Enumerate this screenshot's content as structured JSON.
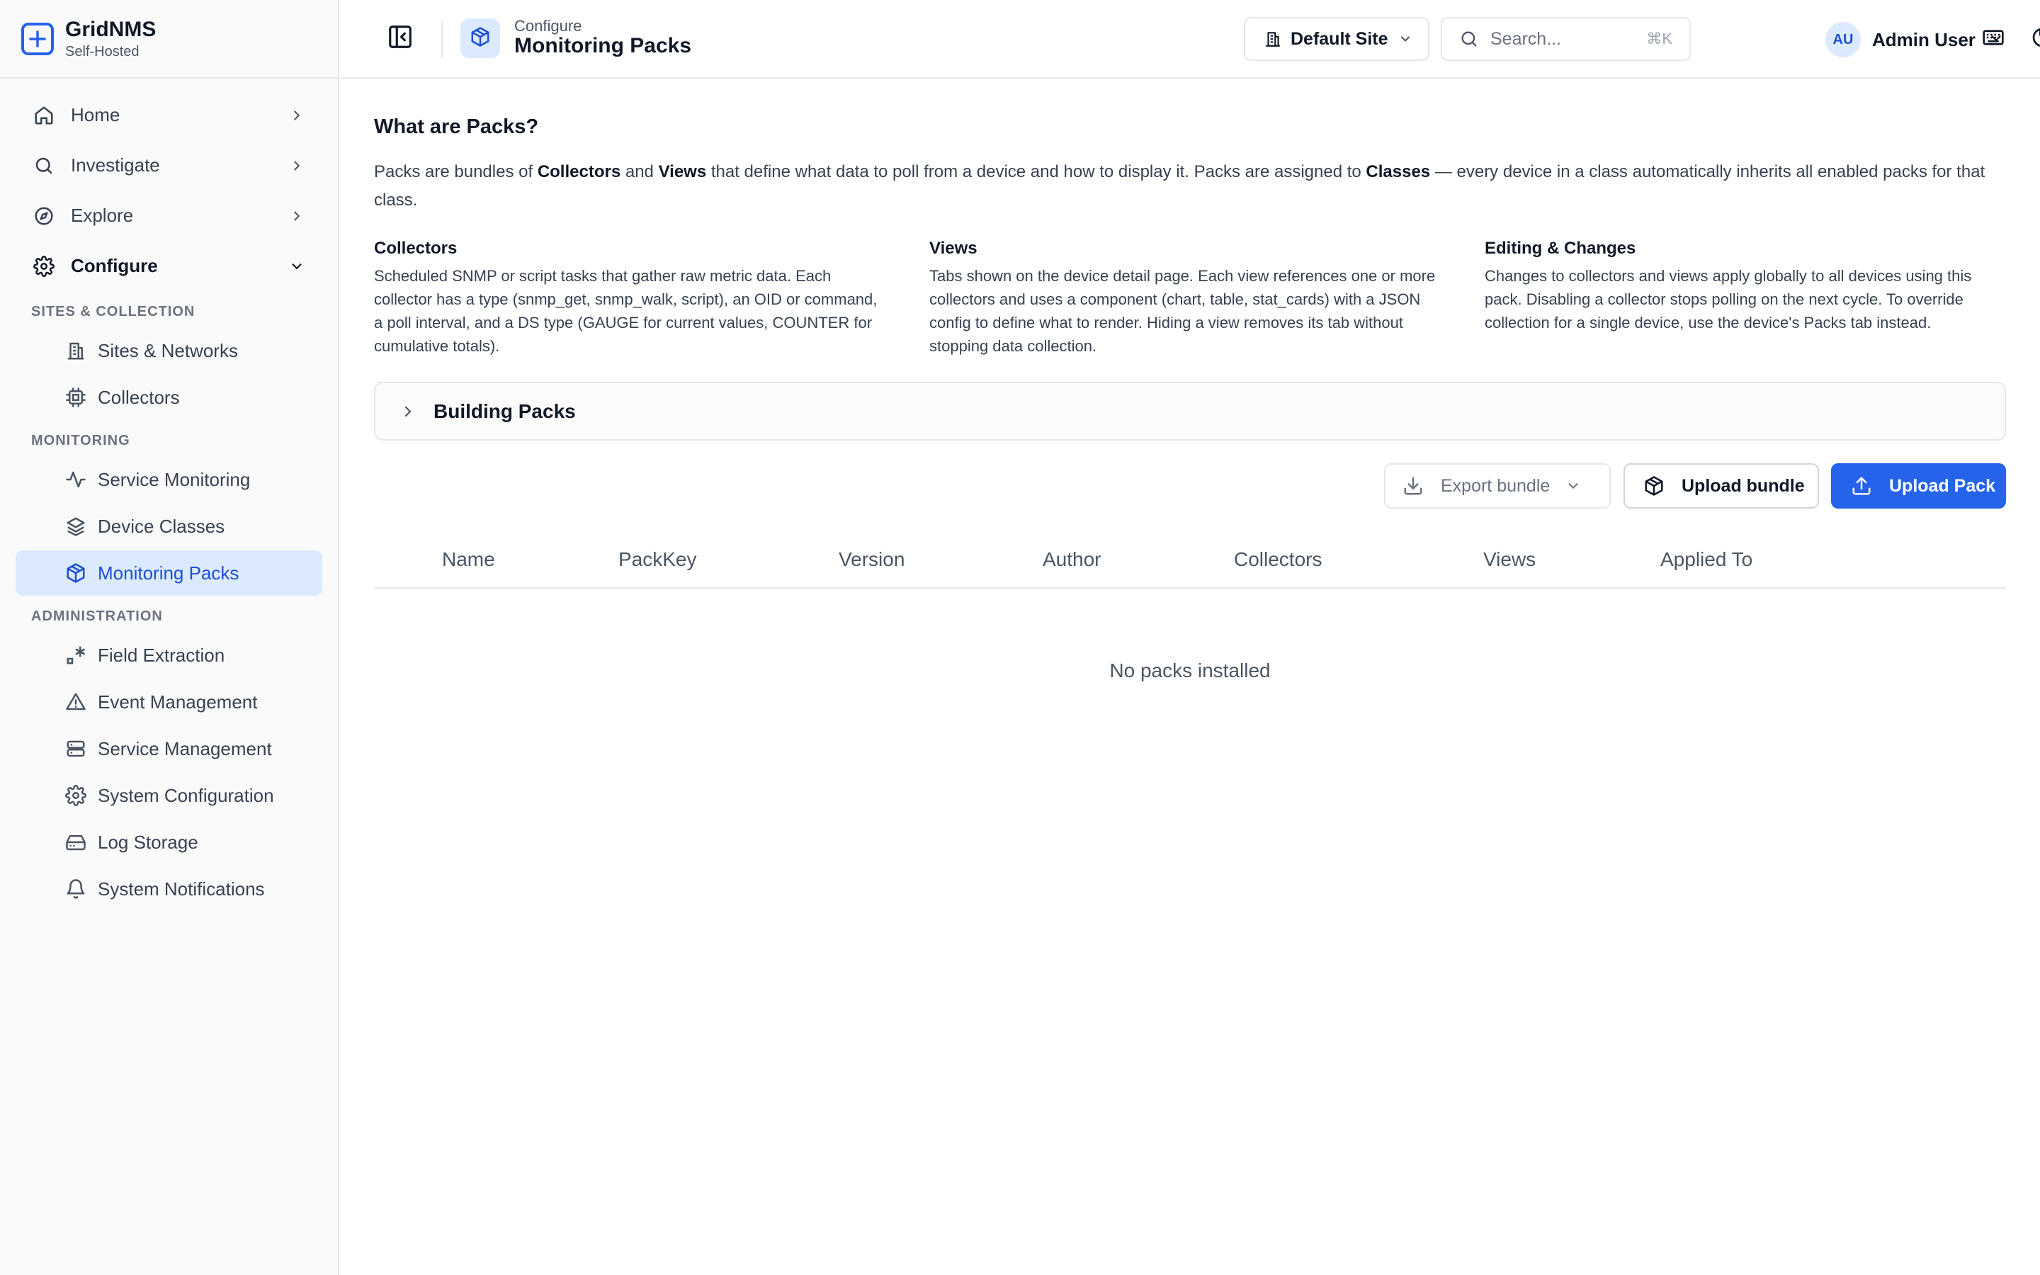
{
  "brand": {
    "name": "GridNMS",
    "subtitle": "Self-Hosted"
  },
  "sidebar": {
    "main_items": [
      {
        "label": "Home",
        "icon": "home-icon"
      },
      {
        "label": "Investigate",
        "icon": "search-icon"
      },
      {
        "label": "Explore",
        "icon": "compass-icon"
      },
      {
        "label": "Configure",
        "icon": "gear-icon",
        "expanded": true
      }
    ],
    "sections": [
      {
        "label": "SITES & COLLECTION",
        "items": [
          {
            "label": "Sites & Networks",
            "icon": "building-icon"
          },
          {
            "label": "Collectors",
            "icon": "cpu-icon"
          }
        ]
      },
      {
        "label": "MONITORING",
        "items": [
          {
            "label": "Service Monitoring",
            "icon": "activity-icon"
          },
          {
            "label": "Device Classes",
            "icon": "layers-icon"
          },
          {
            "label": "Monitoring Packs",
            "icon": "package-icon",
            "active": true
          }
        ]
      },
      {
        "label": "ADMINISTRATION",
        "items": [
          {
            "label": "Field Extraction",
            "icon": "regex-icon"
          },
          {
            "label": "Event Management",
            "icon": "warning-icon"
          },
          {
            "label": "Service Management",
            "icon": "server-icon"
          },
          {
            "label": "System Configuration",
            "icon": "gear-icon"
          },
          {
            "label": "Log Storage",
            "icon": "hard-drive-icon"
          },
          {
            "label": "System Notifications",
            "icon": "bell-icon"
          }
        ]
      }
    ]
  },
  "header": {
    "breadcrumb": "Configure",
    "title": "Monitoring Packs",
    "site_select": "Default Site",
    "search_placeholder": "Search...",
    "search_shortcut": "⌘K",
    "user": {
      "initials": "AU",
      "name": "Admin User"
    }
  },
  "info": {
    "title": "What are Packs?",
    "intro": {
      "p1": "Packs are bundles of ",
      "b1": "Collectors",
      "p2": " and ",
      "b2": "Views",
      "p3": " that define what data to poll from a device and how to display it. Packs are assigned to ",
      "b3": "Classes",
      "p4": " — every device in a class automatically inherits all enabled packs for that class."
    },
    "columns": [
      {
        "title": "Collectors",
        "body": "Scheduled SNMP or script tasks that gather raw metric data. Each collector has a type (snmp_get, snmp_walk, script), an OID or command, a poll interval, and a DS type (GAUGE for current values, COUNTER for cumulative totals)."
      },
      {
        "title": "Views",
        "body": "Tabs shown on the device detail page. Each view references one or more collectors and uses a component (chart, table, stat_cards) with a JSON config to define what to render. Hiding a view removes its tab without stopping data collection."
      },
      {
        "title": "Editing & Changes",
        "body": "Changes to collectors and views apply globally to all devices using this pack. Disabling a collector stops polling on the next cycle. To override collection for a single device, use the device's Packs tab instead."
      }
    ]
  },
  "accordion": {
    "label": "Building Packs"
  },
  "actions": {
    "export": "Export bundle",
    "upload_bundle": "Upload bundle",
    "upload_pack": "Upload Pack"
  },
  "table": {
    "columns": [
      "Name",
      "PackKey",
      "Version",
      "Author",
      "Collectors",
      "Views",
      "Applied To"
    ],
    "empty_text": "No packs installed"
  },
  "colors": {
    "accent": "#2563eb",
    "active_bg": "#dbeafe",
    "active_text": "#1d4ed8"
  }
}
